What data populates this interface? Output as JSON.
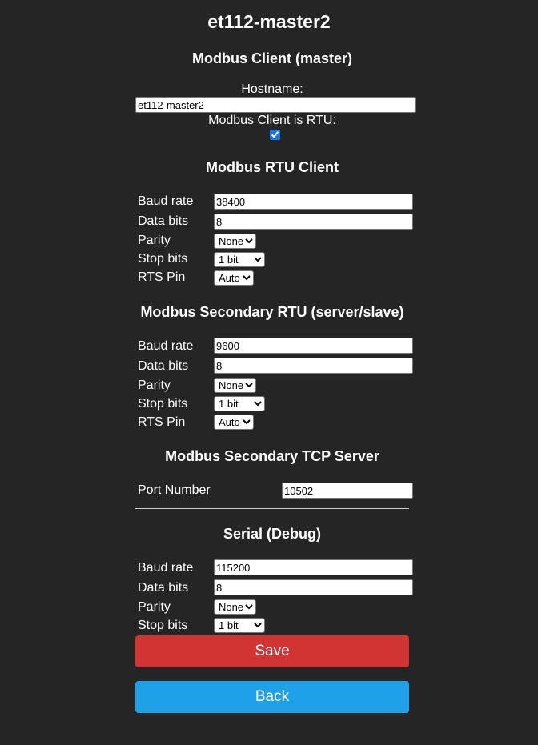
{
  "page_title": "et112-master2",
  "colors": {
    "background": "#252525",
    "save_button": "#d23333",
    "back_button": "#1ea1e8"
  },
  "client": {
    "heading": "Modbus Client (master)",
    "hostname_label": "Hostname:",
    "hostname_value": "et112-master2",
    "is_rtu_label": "Modbus Client is RTU:",
    "is_rtu_checked": true
  },
  "rtu_client": {
    "heading": "Modbus RTU Client",
    "baud_label": "Baud rate",
    "baud_value": "38400",
    "data_bits_label": "Data bits",
    "data_bits_value": "8",
    "parity_label": "Parity",
    "parity_value": "None",
    "stop_bits_label": "Stop bits",
    "stop_bits_value": "1 bit",
    "rts_label": "RTS Pin",
    "rts_value": "Auto"
  },
  "secondary_rtu": {
    "heading": "Modbus Secondary RTU (server/slave)",
    "baud_label": "Baud rate",
    "baud_value": "9600",
    "data_bits_label": "Data bits",
    "data_bits_value": "8",
    "parity_label": "Parity",
    "parity_value": "None",
    "stop_bits_label": "Stop bits",
    "stop_bits_value": "1 bit",
    "rts_label": "RTS Pin",
    "rts_value": "Auto"
  },
  "secondary_tcp": {
    "heading": "Modbus Secondary TCP Server",
    "port_label": "Port Number",
    "port_value": "10502"
  },
  "serial_debug": {
    "heading": "Serial (Debug)",
    "baud_label": "Baud rate",
    "baud_value": "115200",
    "data_bits_label": "Data bits",
    "data_bits_value": "8",
    "parity_label": "Parity",
    "parity_value": "None",
    "stop_bits_label": "Stop bits",
    "stop_bits_value": "1 bit"
  },
  "buttons": {
    "save_label": "Save",
    "back_label": "Back"
  }
}
